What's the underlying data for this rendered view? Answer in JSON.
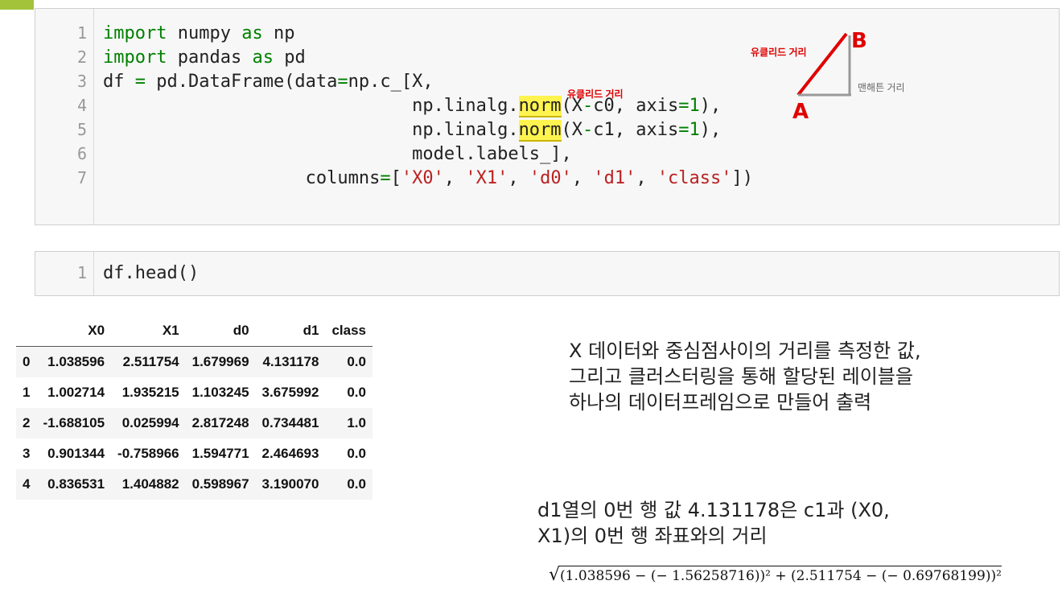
{
  "cell1": {
    "line_numbers": [
      "1",
      "2",
      "3",
      "4",
      "5",
      "6",
      "7"
    ],
    "lines": [
      [
        {
          "t": "import",
          "c": "kw"
        },
        {
          "t": " numpy ",
          "c": ""
        },
        {
          "t": "as",
          "c": "kw"
        },
        {
          "t": " np",
          "c": ""
        }
      ],
      [
        {
          "t": "import",
          "c": "kw"
        },
        {
          "t": " pandas ",
          "c": ""
        },
        {
          "t": "as",
          "c": "kw"
        },
        {
          "t": " pd",
          "c": ""
        }
      ],
      [
        {
          "t": "df ",
          "c": ""
        },
        {
          "t": "=",
          "c": "kw"
        },
        {
          "t": " pd.DataFrame(data",
          "c": ""
        },
        {
          "t": "=",
          "c": "kw"
        },
        {
          "t": "np.c_[X,",
          "c": ""
        }
      ],
      [
        {
          "t": "                             np.linalg.",
          "c": ""
        },
        {
          "t": "norm",
          "c": "hl"
        },
        {
          "t": "(X",
          "c": ""
        },
        {
          "t": "-",
          "c": "kw"
        },
        {
          "t": "c0, axis",
          "c": ""
        },
        {
          "t": "=",
          "c": "kw"
        },
        {
          "t": "1",
          "c": "num"
        },
        {
          "t": "),",
          "c": ""
        }
      ],
      [
        {
          "t": "                             np.linalg.",
          "c": ""
        },
        {
          "t": "norm",
          "c": "hl"
        },
        {
          "t": "(X",
          "c": ""
        },
        {
          "t": "-",
          "c": "kw"
        },
        {
          "t": "c1, axis",
          "c": ""
        },
        {
          "t": "=",
          "c": "kw"
        },
        {
          "t": "1",
          "c": "num"
        },
        {
          "t": "),",
          "c": ""
        }
      ],
      [
        {
          "t": "                             model.labels_],",
          "c": ""
        }
      ],
      [
        {
          "t": "                   columns",
          "c": ""
        },
        {
          "t": "=",
          "c": "kw"
        },
        {
          "t": "[",
          "c": ""
        },
        {
          "t": "'X0'",
          "c": "str"
        },
        {
          "t": ", ",
          "c": ""
        },
        {
          "t": "'X1'",
          "c": "str"
        },
        {
          "t": ", ",
          "c": ""
        },
        {
          "t": "'d0'",
          "c": "str"
        },
        {
          "t": ", ",
          "c": ""
        },
        {
          "t": "'d1'",
          "c": "str"
        },
        {
          "t": ", ",
          "c": ""
        },
        {
          "t": "'class'",
          "c": "str"
        },
        {
          "t": "])",
          "c": ""
        }
      ]
    ]
  },
  "annotations": {
    "euclid_label_1": "유클리드 거리",
    "euclid_label_2": "유클리드 거리",
    "manhattan_label": "맨해튼 거리",
    "point_a": "A",
    "point_b": "B"
  },
  "cell2": {
    "line_number": "1",
    "code": "df.head()"
  },
  "table": {
    "columns": [
      "",
      "X0",
      "X1",
      "d0",
      "d1",
      "class"
    ],
    "rows": [
      [
        "0",
        "1.038596",
        "2.511754",
        "1.679969",
        "4.131178",
        "0.0"
      ],
      [
        "1",
        "1.002714",
        "1.935215",
        "1.103245",
        "3.675992",
        "0.0"
      ],
      [
        "2",
        "-1.688105",
        "0.025994",
        "2.817248",
        "0.734481",
        "1.0"
      ],
      [
        "3",
        "0.901344",
        "-0.758966",
        "1.594771",
        "2.464693",
        "0.0"
      ],
      [
        "4",
        "0.836531",
        "1.404882",
        "0.598967",
        "3.190070",
        "0.0"
      ]
    ]
  },
  "notes": {
    "note1": [
      "X 데이터와 중심점사이의 거리를 측정한 값,",
      "그리고 클러스터링을 통해 할당된 레이블을",
      "하나의 데이터프레임으로 만들어 출력"
    ],
    "note2": [
      "d1열의 0번 행 값 4.131178은 c1과 (X0,",
      "X1)의 0번 행 좌표와의 거리"
    ]
  },
  "formula": {
    "text": "(1.038596 − (− 1.56258716))² + (2.511754 − (− 0.69768199))²"
  }
}
